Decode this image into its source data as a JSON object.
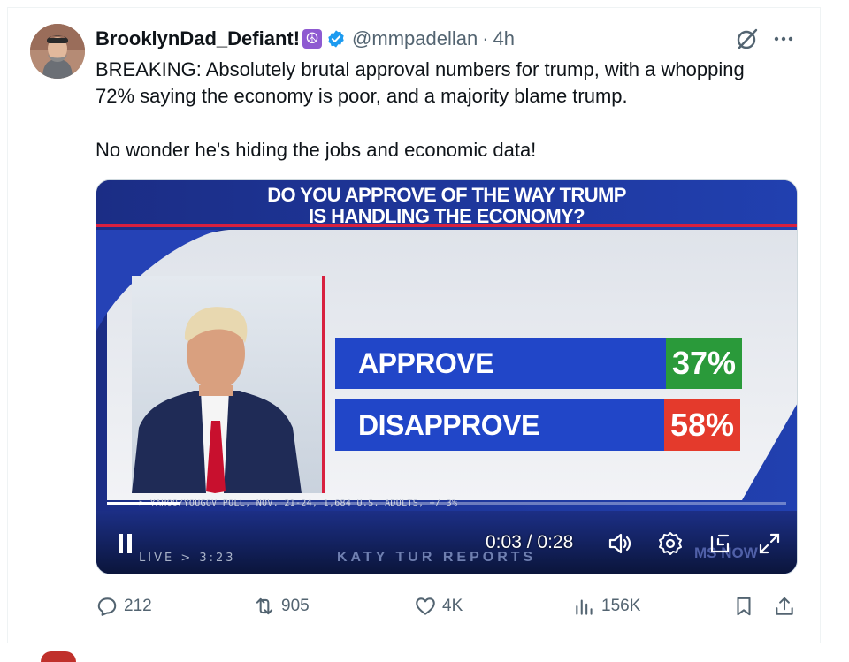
{
  "post": {
    "display_name": "BrooklynDad_Defiant!",
    "name_emoji": "☮",
    "handle": "@mmpadellan",
    "separator": "·",
    "time_ago": "4h",
    "text_line1": "BREAKING: Absolutely brutal approval numbers for trump, with a whopping",
    "text_line2": "72% saying the economy is poor, and a majority blame trump.",
    "text_line3": "No wonder he's hiding the jobs and economic data!"
  },
  "video": {
    "headline_line1": "DO YOU APPROVE OF THE WAY TRUMP",
    "headline_line2": "IS HANDLING THE ECONOMY?",
    "approve_label": "APPROVE",
    "approve_pct": "37%",
    "disapprove_label": "DISAPPROVE",
    "disapprove_pct": "58%",
    "source_text": "> YAHOO/YOUGOV POLL, NOV. 21-24, 1,684 U.S. ADULTS, +/ 3%",
    "live_text": "LIVE > 3:23",
    "show_text": "KATY TUR REPORTS",
    "channel_text": "MS NOW",
    "elapsed": "0:03",
    "duration": "0:28",
    "progress_fraction": 0.107,
    "colors": {
      "approve_badge": "#2a9a3a",
      "disapprove_badge": "#e43a2c",
      "bar": "#2146c8",
      "accent_line": "#d8203f"
    }
  },
  "engagement": {
    "replies": "212",
    "reposts": "905",
    "likes": "4K",
    "views": "156K"
  },
  "icons": [
    "verified-badge-icon",
    "grok-icon",
    "more-icon",
    "reply-icon",
    "repost-icon",
    "like-icon",
    "views-icon",
    "bookmark-icon",
    "share-icon",
    "pause-icon",
    "volume-icon",
    "settings-icon",
    "minimize-icon",
    "fullscreen-icon"
  ]
}
